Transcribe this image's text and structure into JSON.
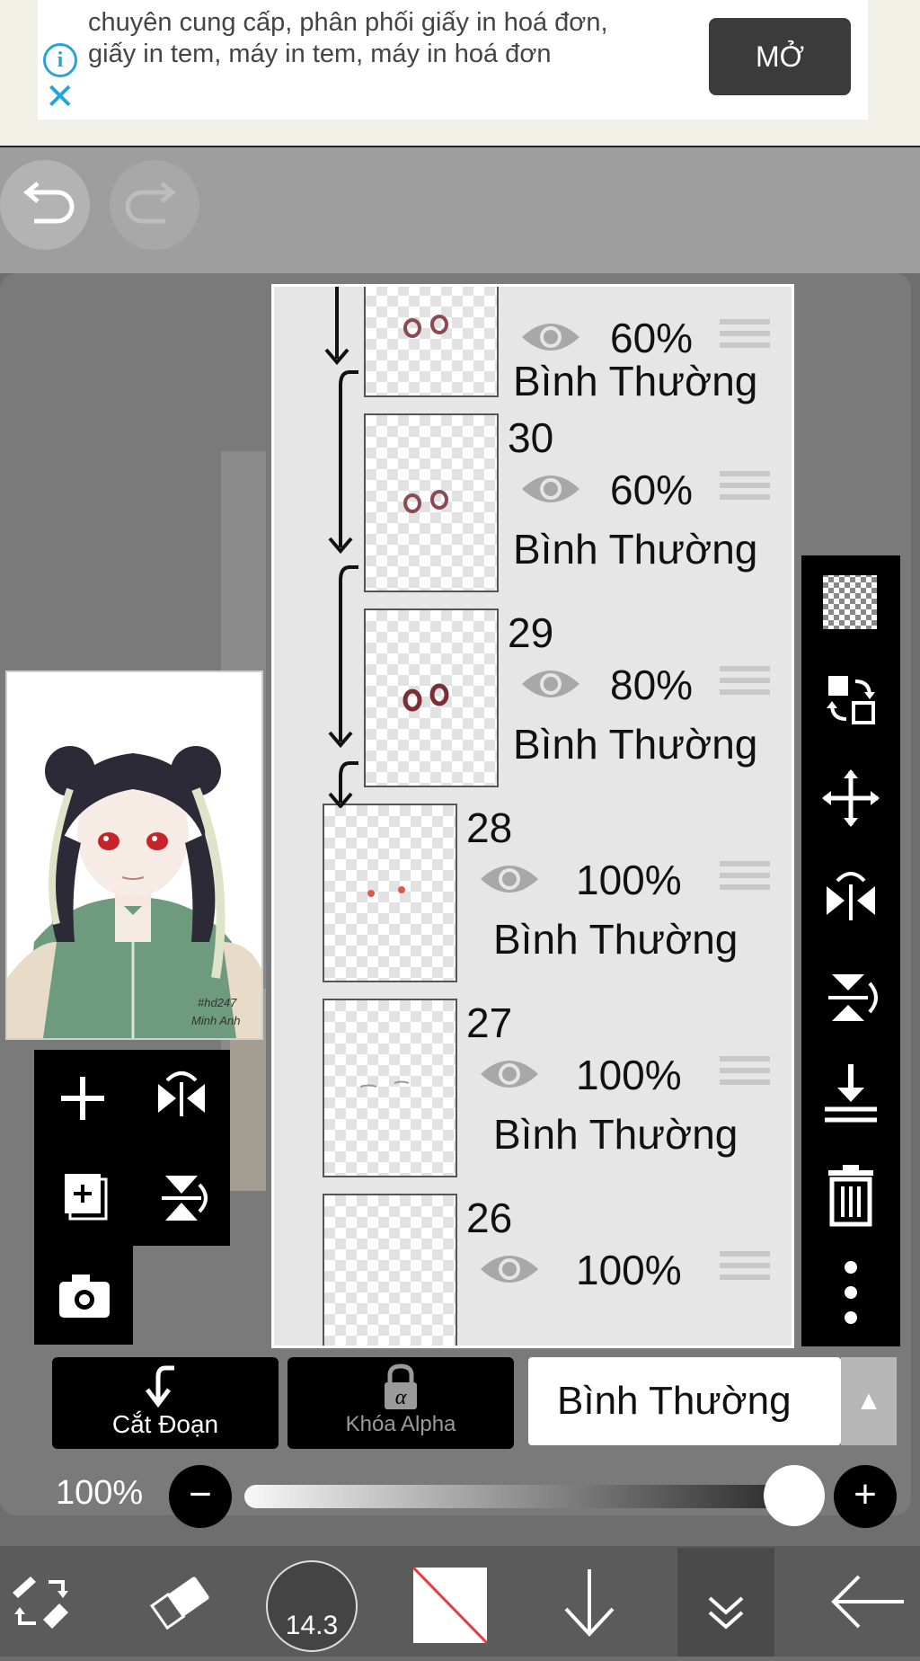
{
  "ad": {
    "info_icon": "info-icon",
    "close_icon": "close-icon",
    "text": "chuyên cung cấp, phân phối giấy in hoá đơn, giấy in tem, máy in tem, máy in hoá đơn",
    "open_label": "MỞ"
  },
  "toolbar": {
    "undo_icon": "undo-icon",
    "redo_icon": "redo-icon"
  },
  "layers": [
    {
      "number": "",
      "opacity": "60%",
      "blend": "Bình Thường",
      "clipped": true
    },
    {
      "number": "30",
      "opacity": "60%",
      "blend": "Bình Thường",
      "clipped": true
    },
    {
      "number": "29",
      "opacity": "80%",
      "blend": "Bình Thường",
      "clipped": true
    },
    {
      "number": "28",
      "opacity": "100%",
      "blend": "Bình Thường",
      "clipped": false
    },
    {
      "number": "27",
      "opacity": "100%",
      "blend": "Bình Thường",
      "clipped": false
    },
    {
      "number": "26",
      "opacity": "100%",
      "blend": "",
      "clipped": false
    }
  ],
  "preview": {
    "signature": "#hd247\nMinh Anh"
  },
  "controls": {
    "clip_label": "Cắt Đoạn",
    "alpha_label": "Khóa Alpha",
    "blend_mode": "Bình Thường",
    "opacity_label": "100%",
    "opacity_value": 1.0
  },
  "bottom": {
    "brush_size": "14.3"
  },
  "colors": {
    "accent": "#27a3d8",
    "panel": "#7a7a7a",
    "dark": "#000000",
    "primary_color": "#e23b3b"
  }
}
